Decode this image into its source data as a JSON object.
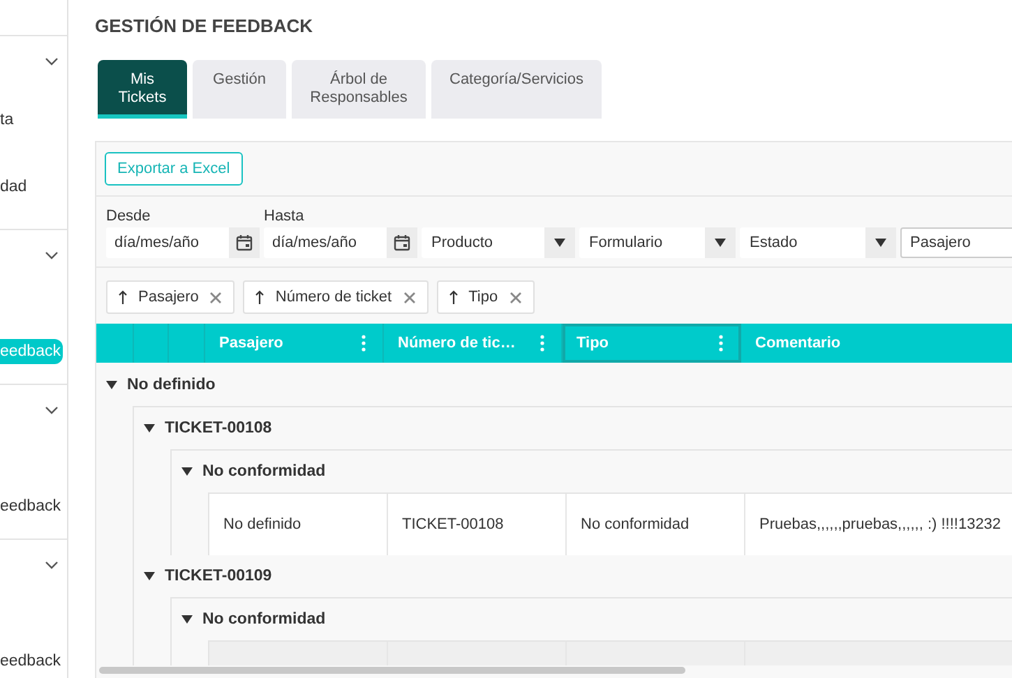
{
  "sidebar": {
    "groups": [
      {
        "expanded": true,
        "items": [
          {
            "label": "ta",
            "selected": false
          },
          {
            "label": "dad",
            "selected": false
          }
        ]
      },
      {
        "expanded": true,
        "items": [
          {
            "label": "eedback",
            "selected": true
          }
        ]
      },
      {
        "expanded": true,
        "items": [
          {
            "label": "eedback",
            "selected": false
          }
        ]
      },
      {
        "expanded": true,
        "items": [
          {
            "label": "eedback",
            "selected": false
          }
        ]
      }
    ]
  },
  "page_title": "GESTIÓN DE FEEDBACK",
  "tabs": [
    {
      "label": "Mis Tickets",
      "selected": true
    },
    {
      "label": "Gestión",
      "selected": false
    },
    {
      "label": "Árbol de Responsables",
      "selected": false
    },
    {
      "label": "Categoría/Servicios",
      "selected": false
    }
  ],
  "export_button": "Exportar a Excel",
  "filters": [
    {
      "kind": "date",
      "label": "Desde",
      "placeholder": "día/mes/año"
    },
    {
      "kind": "date",
      "label": "Hasta",
      "placeholder": "día/mes/año"
    },
    {
      "kind": "select",
      "value": "Producto"
    },
    {
      "kind": "select",
      "value": "Formulario"
    },
    {
      "kind": "select",
      "value": "Estado"
    },
    {
      "kind": "text",
      "placeholder": "Pasajero"
    }
  ],
  "sort_chips": [
    {
      "label": "Pasajero"
    },
    {
      "label": "Número de ticket"
    },
    {
      "label": "Tipo"
    }
  ],
  "table": {
    "columns": [
      {
        "label": "Pasajero",
        "selected": false
      },
      {
        "label": "Número de tic…",
        "selected": false
      },
      {
        "label": "Tipo",
        "selected": true
      },
      {
        "label": "Comentario",
        "selected": false
      }
    ],
    "groups": [
      {
        "label": "No definido",
        "expanded": true,
        "children": [
          {
            "label": "TICKET-00108",
            "expanded": true,
            "children": [
              {
                "label": "No conformidad",
                "expanded": true,
                "rows": [
                  {
                    "cells": [
                      "No definido",
                      "TICKET-00108",
                      "No conformidad",
                      "Pruebas,,,,,,pruebas,,,,,, :) !!!!13232"
                    ],
                    "highlighted": false
                  }
                ]
              }
            ]
          },
          {
            "label": "TICKET-00109",
            "expanded": true,
            "children": [
              {
                "label": "No conformidad",
                "expanded": true,
                "rows": [
                  {
                    "highlighted": true
                  }
                ]
              }
            ]
          }
        ]
      }
    ]
  }
}
